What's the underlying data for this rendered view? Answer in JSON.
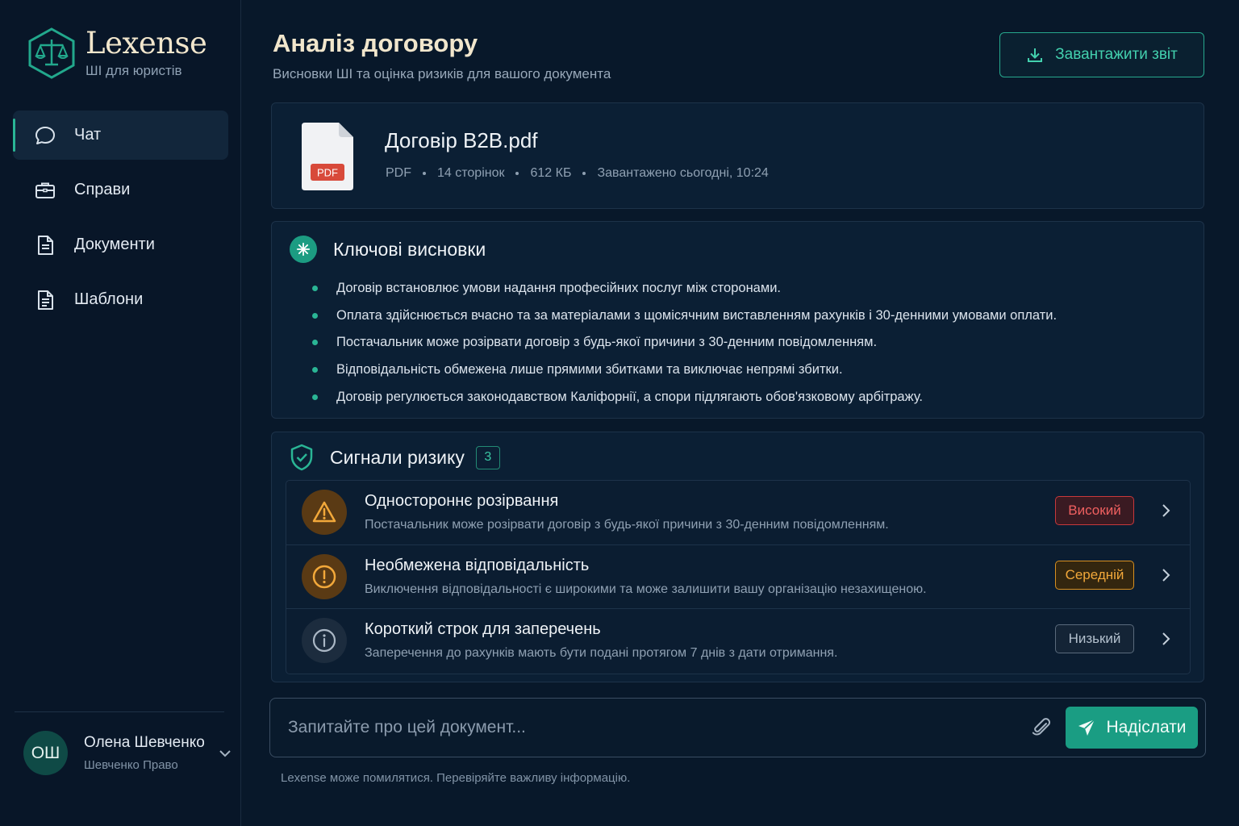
{
  "brand": {
    "name": "Lexense",
    "tagline": "ШІ для юристів"
  },
  "nav": [
    {
      "label": "Чат",
      "icon": "chat-bubble-icon",
      "active": true
    },
    {
      "label": "Справи",
      "icon": "briefcase-icon",
      "active": false
    },
    {
      "label": "Документи",
      "icon": "document-icon",
      "active": false
    },
    {
      "label": "Шаблони",
      "icon": "template-icon",
      "active": false
    }
  ],
  "user": {
    "initials": "ОШ",
    "name": "Олена Шевченко",
    "org": "Шевченко Право"
  },
  "header": {
    "title": "Аналіз договору",
    "subtitle": "Висновки ШІ та оцінка ризиків для вашого документа",
    "download_label": "Завантажити звіт"
  },
  "file": {
    "badge": "PDF",
    "name": "Договір B2B.pdf",
    "type": "PDF",
    "pages": "14 сторінок",
    "size": "612 КБ",
    "uploaded": "Завантажено сьогодні, 10:24"
  },
  "findings": {
    "title": "Ключові висновки",
    "items": [
      "Договір встановлює  умови надання професійних послуг між сторонами.",
      "Оплата здійснюється вчасно та за матеріалами з щомісячним виставленням рахунків і 30-денними умовами оплати.",
      "Постачальник може розірвати договір з будь-якої причини з 30-денним повідомленням.",
      "Відповідальність обмежена лише прямими збитками та виключає непрямі збитки.",
      "Договір регулюється законодавством Каліфорнії, а спори підлягають обов'язковому арбітражу."
    ]
  },
  "risks": {
    "title": "Сигнали ризику",
    "count": "3",
    "items": [
      {
        "title": "Одностороннє розірвання",
        "desc": "Постачальник може розірвати договір з будь-якої причини з 30-денним повідомленням.",
        "level": "Високий",
        "icon": "warning-triangle-icon"
      },
      {
        "title": "Необмежена відповідальність",
        "desc": "Виключення відповідальності є широкими та може залишити вашу організацію незахищеною.",
        "level": "Середній",
        "icon": "exclamation-circle-icon"
      },
      {
        "title": "Короткий строк для заперечень",
        "desc": "Заперечення до рахунків мають бути подані протягом 7 днів з дати отримання.",
        "level": "Низький",
        "icon": "info-circle-icon"
      }
    ]
  },
  "chat": {
    "placeholder": "Запитайте про цей документ...",
    "send_label": "Надіслати",
    "disclaimer": "Lexense може помилятися. Перевіряйте важливу інформацію."
  },
  "colors": {
    "accent": "#2ab595",
    "high": "#f06060",
    "medium": "#f2a83a",
    "low": "#b3c0cd"
  }
}
